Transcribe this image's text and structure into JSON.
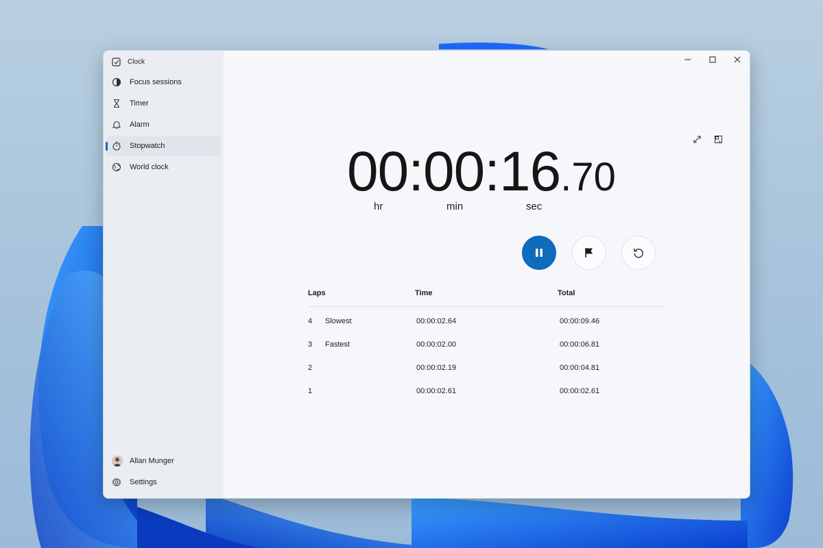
{
  "app": {
    "title": "Clock"
  },
  "window_controls": {
    "minimize": "—",
    "maximize": "☐",
    "close": "✕"
  },
  "nav": {
    "items": [
      {
        "label": "Focus sessions",
        "icon": "focus-icon",
        "selected": false
      },
      {
        "label": "Timer",
        "icon": "hourglass-icon",
        "selected": false
      },
      {
        "label": "Alarm",
        "icon": "bell-icon",
        "selected": false
      },
      {
        "label": "Stopwatch",
        "icon": "stopwatch-icon",
        "selected": true
      },
      {
        "label": "World clock",
        "icon": "globe-icon",
        "selected": false
      }
    ],
    "user": {
      "name": "Allan Munger"
    },
    "settings": {
      "label": "Settings"
    }
  },
  "stopwatch": {
    "hours": "00",
    "minutes": "00",
    "seconds": "16",
    "hundredths": "70",
    "sep": ":",
    "dot": ".",
    "units": {
      "hr": "hr",
      "min": "min",
      "sec": "sec"
    }
  },
  "laps": {
    "headers": {
      "laps": "Laps",
      "time": "Time",
      "total": "Total"
    },
    "rows": [
      {
        "num": "4",
        "tag": "Slowest",
        "time": "00:00:02.64",
        "total": "00:00:09.46"
      },
      {
        "num": "3",
        "tag": "Fastest",
        "time": "00:00:02.00",
        "total": "00:00:06.81"
      },
      {
        "num": "2",
        "tag": "",
        "time": "00:00:02.19",
        "total": "00:00:04.81"
      },
      {
        "num": "1",
        "tag": "",
        "time": "00:00:02.61",
        "total": "00:00:02.61"
      }
    ]
  },
  "colors": {
    "accent": "#0f6cbd",
    "window_bg": "#f5f7fb",
    "sidebar_bg": "#eaeef3"
  }
}
